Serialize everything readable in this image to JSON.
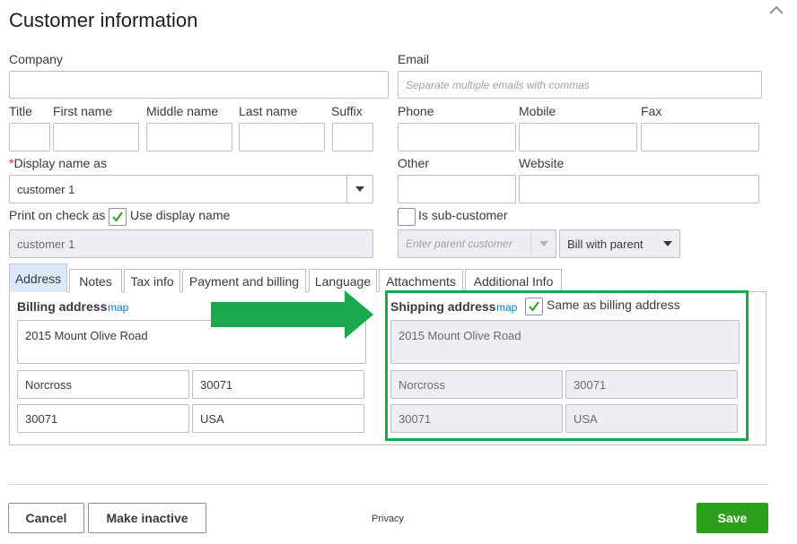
{
  "header": {
    "title": "Customer information",
    "collapse_icon": "chevron-up-icon"
  },
  "labels": {
    "company": "Company",
    "email": "Email",
    "title": "Title",
    "first_name": "First name",
    "middle_name": "Middle name",
    "last_name": "Last name",
    "suffix": "Suffix",
    "phone": "Phone",
    "mobile": "Mobile",
    "fax": "Fax",
    "display_name_required": "*",
    "display_name": "Display name as",
    "other": "Other",
    "website": "Website",
    "print_on_check": "Print on check as",
    "use_display_name": "Use display name",
    "is_sub_customer": "Is sub-customer"
  },
  "fields": {
    "company": "",
    "email_placeholder": "Separate multiple emails with commas",
    "display_name": "customer 1",
    "print_on_check": "customer 1",
    "parent_customer_placeholder": "Enter parent customer",
    "bill_with": "Bill with parent"
  },
  "checks": {
    "use_display_name": true,
    "is_sub_customer": false,
    "same_as_billing": true
  },
  "tabs": [
    "Address",
    "Notes",
    "Tax info",
    "Payment and billing",
    "Language",
    "Attachments",
    "Additional Info"
  ],
  "active_tab": "Address",
  "billing": {
    "label": "Billing address",
    "map": "map",
    "street": "2015  Mount Olive Road",
    "city": "Norcross",
    "state": "30071",
    "zip": "30071",
    "country": "USA"
  },
  "shipping": {
    "label": "Shipping address",
    "map": "map",
    "same_label": "Same as billing address",
    "street": "2015  Mount Olive Road",
    "city": "Norcross",
    "state": "30071",
    "zip": "30071",
    "country": "USA"
  },
  "footer": {
    "cancel": "Cancel",
    "make_inactive": "Make inactive",
    "privacy": "Privacy",
    "save": "Save"
  },
  "colors": {
    "primary": "#2ca01c",
    "annotation": "#1ba84d",
    "link": "#0077c5",
    "active_tab": "#dbe9fa"
  }
}
